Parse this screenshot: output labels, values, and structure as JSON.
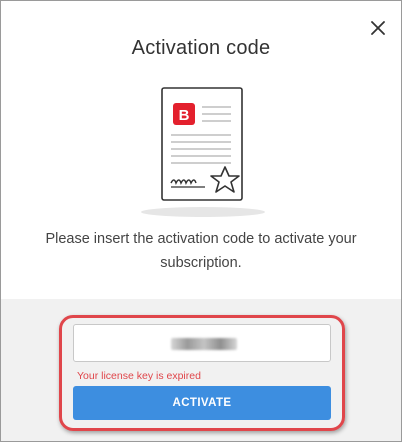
{
  "dialog": {
    "title": "Activation code",
    "message": "Please insert the activation code to activate your subscription.",
    "close_icon": "close-icon",
    "illustration_icon": "certificate-icon",
    "brand_badge": {
      "letter": "B",
      "color": "#e3202d"
    }
  },
  "form": {
    "code_input": {
      "value": "",
      "placeholder": ""
    },
    "error": "Your license key is expired",
    "activate_label": "ACTIVATE"
  },
  "colors": {
    "accent": "#3d8ee0",
    "error": "#e0464b",
    "brand": "#e3202d"
  }
}
